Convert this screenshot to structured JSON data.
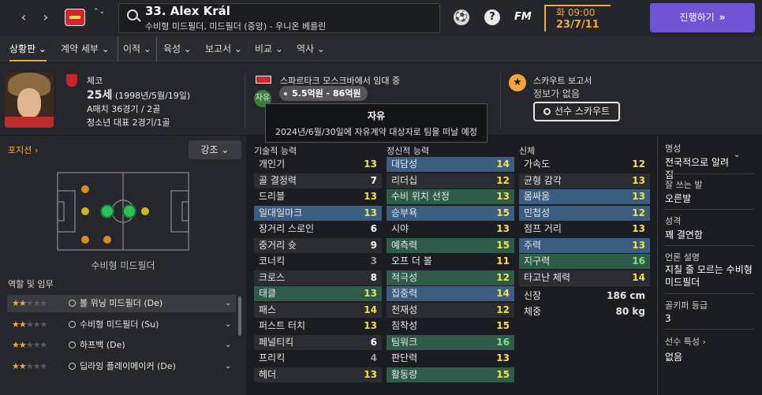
{
  "topbar": {
    "back_arrow": "‹",
    "forward_arrow": "›",
    "stepper": "⌃⌄",
    "player_title": "33. Alex Král",
    "player_subtitle": "수비형 미드필더, 미드필더 (중앙) - 우니온 베를린",
    "icon_help": "?",
    "icon_fm": "FM",
    "date_day": "화 09:00",
    "date_value": "23/7/11",
    "continue_label": "진행하기",
    "continue_arrows": "»"
  },
  "tabs": [
    {
      "label": "상황판 ⌄"
    },
    {
      "label": "계약 세부 ⌄"
    },
    {
      "label": "이적 ⌄"
    },
    {
      "label": "육성 ⌄"
    },
    {
      "label": "보고서 ⌄"
    },
    {
      "label": "비교 ⌄"
    },
    {
      "label": "역사 ⌄"
    }
  ],
  "profile": {
    "nation": "체코",
    "age_number": "25세",
    "age_birth": " (1998년/5월/19일)",
    "caps": "A매치 36경기 / 2골",
    "youth": "청소년 대표 2경기/1골",
    "loan_text": "스파르타크 모스크바에서 임대 중",
    "free_badge": "자유",
    "value": "5.5억원 - 86억원",
    "scout_title": "스카우트 보고서",
    "scout_none": "정보가 없음",
    "scout_button": "선수 스카우트"
  },
  "tooltip": {
    "title": "자유",
    "body": "2024년/6월/30일에 자유계약 대상자로 팀을 떠날 예정"
  },
  "position_panel": {
    "link": "포지션 ›",
    "emphasis": "강조  ⌄",
    "caption": "수비형 미드필더",
    "roles_title": "역할 및 임무",
    "roles": [
      {
        "stars": 2,
        "name": "볼 위닝 미드필더 (De)",
        "chev": "⌄"
      },
      {
        "stars": 2,
        "name": "수비형 미드필더 (Su)",
        "chev": "⌄"
      },
      {
        "stars": 2,
        "name": "하프백 (De)",
        "chev": "⌄"
      },
      {
        "stars": 2,
        "name": "딥라잉 플레이메이커 (De)",
        "chev": "⌄"
      }
    ]
  },
  "pitch_markers": {
    "colors": {
      "green": "#2fbf5a",
      "yellow": "#c9b81e",
      "orange": "#d98a1e",
      "line": "#8a8b91"
    }
  },
  "attributes": {
    "technical_title": "기술적 능력",
    "mental_title": "정신적 능력",
    "physical_title": "신체",
    "technical": [
      {
        "name": "개인기",
        "value": "13",
        "tone": "y",
        "hl": ""
      },
      {
        "name": "골 결정력",
        "value": "7",
        "tone": "w",
        "hl": ""
      },
      {
        "name": "드리블",
        "value": "13",
        "tone": "y",
        "hl": ""
      },
      {
        "name": "일대일마크",
        "value": "13",
        "tone": "y",
        "hl": "hl"
      },
      {
        "name": "장거리 스로인",
        "value": "6",
        "tone": "w",
        "hl": ""
      },
      {
        "name": "중거리 슛",
        "value": "9",
        "tone": "w",
        "hl": ""
      },
      {
        "name": "코너킥",
        "value": "3",
        "tone": "grey",
        "hl": ""
      },
      {
        "name": "크로스",
        "value": "8",
        "tone": "w",
        "hl": ""
      },
      {
        "name": "태클",
        "value": "13",
        "tone": "y",
        "hl": "hl-green"
      },
      {
        "name": "패스",
        "value": "14",
        "tone": "y",
        "hl": ""
      },
      {
        "name": "퍼스트 터치",
        "value": "13",
        "tone": "y",
        "hl": ""
      },
      {
        "name": "페널티킥",
        "value": "6",
        "tone": "w",
        "hl": ""
      },
      {
        "name": "프리킥",
        "value": "4",
        "tone": "grey",
        "hl": ""
      },
      {
        "name": "헤더",
        "value": "13",
        "tone": "y",
        "hl": ""
      }
    ],
    "mental": [
      {
        "name": "대담성",
        "value": "14",
        "tone": "y",
        "hl": "hl"
      },
      {
        "name": "리더십",
        "value": "12",
        "tone": "y",
        "hl": ""
      },
      {
        "name": "수비 위치 선정",
        "value": "13",
        "tone": "y",
        "hl": "hl-green"
      },
      {
        "name": "승부욕",
        "value": "15",
        "tone": "y",
        "hl": "hl"
      },
      {
        "name": "시야",
        "value": "13",
        "tone": "y",
        "hl": ""
      },
      {
        "name": "예측력",
        "value": "15",
        "tone": "y",
        "hl": "hl-green"
      },
      {
        "name": "오프 더 볼",
        "value": "11",
        "tone": "y",
        "hl": ""
      },
      {
        "name": "적극성",
        "value": "12",
        "tone": "y",
        "hl": "hl-green"
      },
      {
        "name": "집중력",
        "value": "14",
        "tone": "y",
        "hl": "hl"
      },
      {
        "name": "천재성",
        "value": "12",
        "tone": "y",
        "hl": ""
      },
      {
        "name": "침착성",
        "value": "15",
        "tone": "y",
        "hl": ""
      },
      {
        "name": "팀워크",
        "value": "16",
        "tone": "g",
        "hl": "hl-green"
      },
      {
        "name": "판단력",
        "value": "13",
        "tone": "y",
        "hl": ""
      },
      {
        "name": "활동량",
        "value": "15",
        "tone": "y",
        "hl": "hl-green"
      }
    ],
    "physical": [
      {
        "name": "가속도",
        "value": "12",
        "tone": "y",
        "hl": ""
      },
      {
        "name": "균형 감각",
        "value": "13",
        "tone": "y",
        "hl": ""
      },
      {
        "name": "몸싸움",
        "value": "13",
        "tone": "y",
        "hl": "hl"
      },
      {
        "name": "민첩성",
        "value": "12",
        "tone": "y",
        "hl": "hl"
      },
      {
        "name": "점프 거리",
        "value": "13",
        "tone": "y",
        "hl": ""
      },
      {
        "name": "주력",
        "value": "13",
        "tone": "y",
        "hl": "hl"
      },
      {
        "name": "지구력",
        "value": "16",
        "tone": "g",
        "hl": "hl-green"
      },
      {
        "name": "타고난 체력",
        "value": "14",
        "tone": "y",
        "hl": ""
      }
    ],
    "height_label": "신장",
    "height_value": "186 cm",
    "weight_label": "체중",
    "weight_value": "80 kg"
  },
  "info": {
    "reputation_label": "명성",
    "reputation_value": "전국적으로 알려짐",
    "reputation_chev": "⌄",
    "foot_label": "잘 쓰는 발",
    "foot_value": "오른발",
    "personality_label": "성격",
    "personality_value": "꽤 결연함",
    "media_label": "언론 설명",
    "media_value": "지칠 줄 모르는 수비형 미드필더",
    "keeper_label": "골키퍼 등급",
    "keeper_value": "3",
    "traits_label": "선수 특성 ›",
    "traits_value": "없음"
  }
}
